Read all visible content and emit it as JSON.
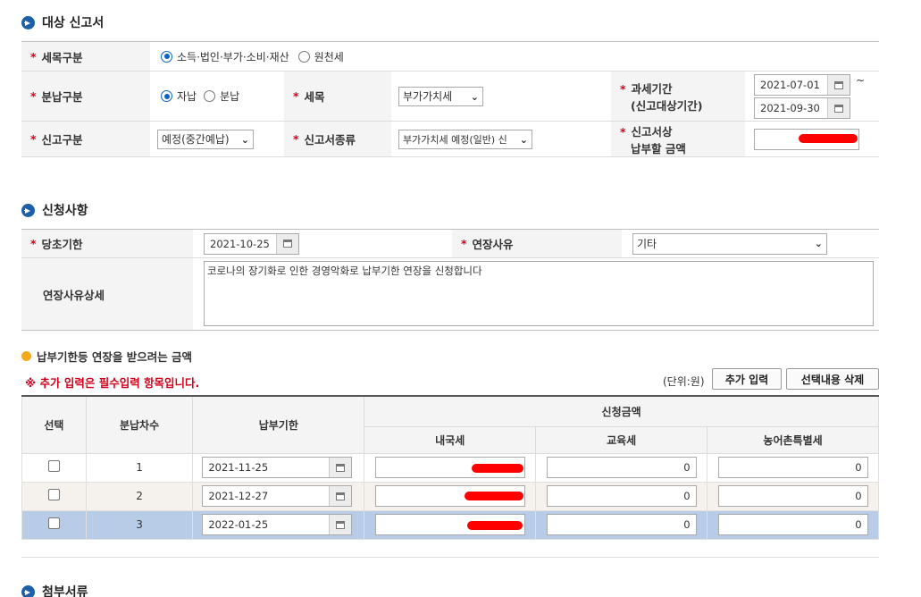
{
  "section1": {
    "title": "대상 신고서",
    "tax_category": {
      "label": "세목구분",
      "options": [
        "소득·법인·부가·소비·재산",
        "원천세"
      ],
      "selected": 0
    },
    "payment_type": {
      "label": "분납구분",
      "options": [
        "자납",
        "분납"
      ],
      "selected": 0
    },
    "tax_item": {
      "label": "세목",
      "value": "부가가치세"
    },
    "tax_period": {
      "label_line1": "과세기간",
      "label_line2": "(신고대상기간)",
      "from": "2021-07-01",
      "to": "2021-09-30",
      "tilde": "~"
    },
    "report_type": {
      "label": "신고구분",
      "value": "예정(중간예납)"
    },
    "report_kind": {
      "label": "신고서종류",
      "value": "부가가치세 예정(일반) 신"
    },
    "report_amount": {
      "label_line1": "신고서상",
      "label_line2": "납부할 금액"
    }
  },
  "section2": {
    "title": "신청사항",
    "original_deadline": {
      "label": "당초기한",
      "value": "2021-10-25"
    },
    "extension_reason": {
      "label": "연장사유",
      "value": "기타"
    },
    "reason_detail": {
      "label": "연장사유상세",
      "value": "코로나의 장기화로 인한 경영악화로 납부기한 연장을 신청합니다"
    }
  },
  "subsection": {
    "title": "납부기한등 연장을 받으려는 금액",
    "notice": "※ 추가 입력은 필수입력 항목입니다.",
    "unit": "(단위:원)",
    "add_button": "추가 입력",
    "delete_button": "선택내용 삭제"
  },
  "table": {
    "headers": {
      "select": "선택",
      "seq": "분납차수",
      "deadline": "납부기한",
      "amount_group": "신청금액",
      "domestic": "내국세",
      "education": "교육세",
      "rural": "농어촌특별세"
    },
    "rows": [
      {
        "seq": "1",
        "deadline": "2021-11-25",
        "education": "0",
        "rural": "0"
      },
      {
        "seq": "2",
        "deadline": "2021-12-27",
        "education": "0",
        "rural": "0"
      },
      {
        "seq": "3",
        "deadline": "2022-01-25",
        "education": "0",
        "rural": "0"
      }
    ]
  },
  "section3": {
    "title": "첨부서류"
  },
  "colors": {
    "required_star": "#d0021b",
    "section_icon": "#1d5fa8",
    "selected_row": "#b8cce8"
  }
}
